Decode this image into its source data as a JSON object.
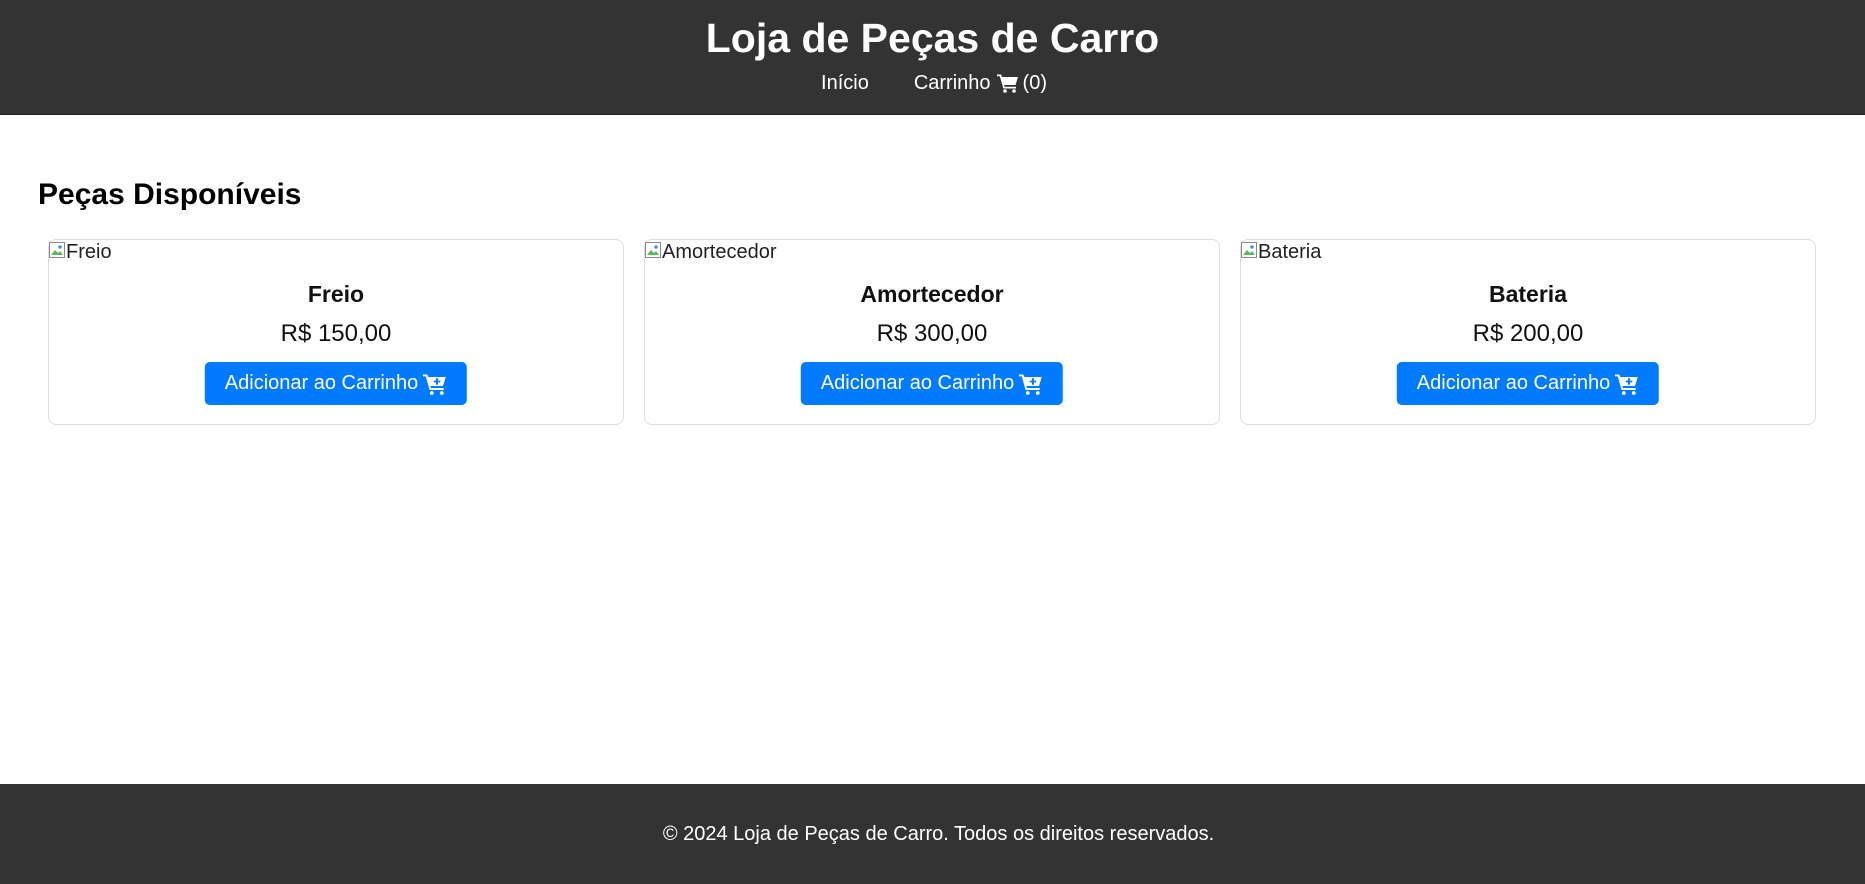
{
  "header": {
    "title": "Loja de Peças de Carro",
    "nav": {
      "home_label": "Início",
      "cart_label": "Carrinho",
      "cart_count": "(0)"
    }
  },
  "main": {
    "section_title": "Peças Disponíveis",
    "products": [
      {
        "image_alt": "Freio",
        "name": "Freio",
        "price": "R$ 150,00",
        "button_label": "Adicionar ao Carrinho"
      },
      {
        "image_alt": "Amortecedor",
        "name": "Amortecedor",
        "price": "R$ 300,00",
        "button_label": "Adicionar ao Carrinho"
      },
      {
        "image_alt": "Bateria",
        "name": "Bateria",
        "price": "R$ 200,00",
        "button_label": "Adicionar ao Carrinho"
      }
    ]
  },
  "footer": {
    "text": "© 2024 Loja de Peças de Carro. Todos os direitos reservados."
  },
  "icons": {
    "nav_cart": "shopping-cart-icon",
    "add_to_cart": "cart-plus-icon",
    "broken_image": "broken-image-icon"
  },
  "colors": {
    "header_bg": "#333333",
    "footer_bg": "#333333",
    "button_bg": "#007bff",
    "card_border": "#dddddd"
  }
}
